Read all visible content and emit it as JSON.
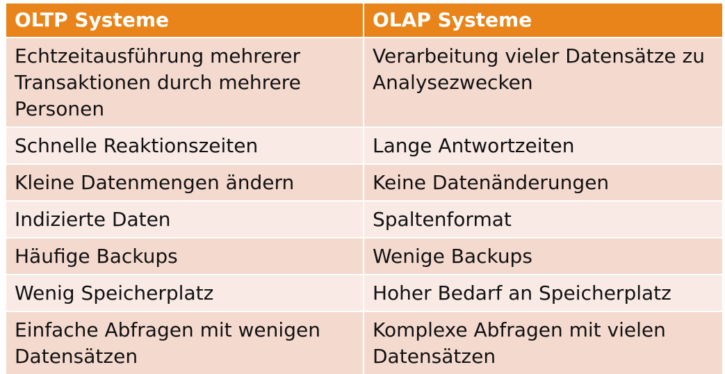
{
  "table": {
    "headers": [
      "OLTP Systeme",
      "OLAP Systeme"
    ],
    "rows": [
      [
        "Echtzeitausführung mehrerer Transaktionen durch mehrere Personen",
        "Verarbeitung vieler Datensätze zu Analysezwecken"
      ],
      [
        "Schnelle Reaktionszeiten",
        "Lange Antwortzeiten"
      ],
      [
        "Kleine Datenmengen ändern",
        "Keine Datenänderungen"
      ],
      [
        "Indizierte Daten",
        "Spaltenformat"
      ],
      [
        "Häufige Backups",
        "Wenige Backups"
      ],
      [
        "Wenig Speicherplatz",
        "Hoher Bedarf an Speicherplatz"
      ],
      [
        "Einfache Abfragen mit wenigen Datensätzen",
        "Komplexe Abfragen mit vielen Datensätzen"
      ]
    ],
    "colors": {
      "header_bg": "#e8841a",
      "row_dark": "#f4d9cf",
      "row_light": "#f9eae5"
    }
  }
}
